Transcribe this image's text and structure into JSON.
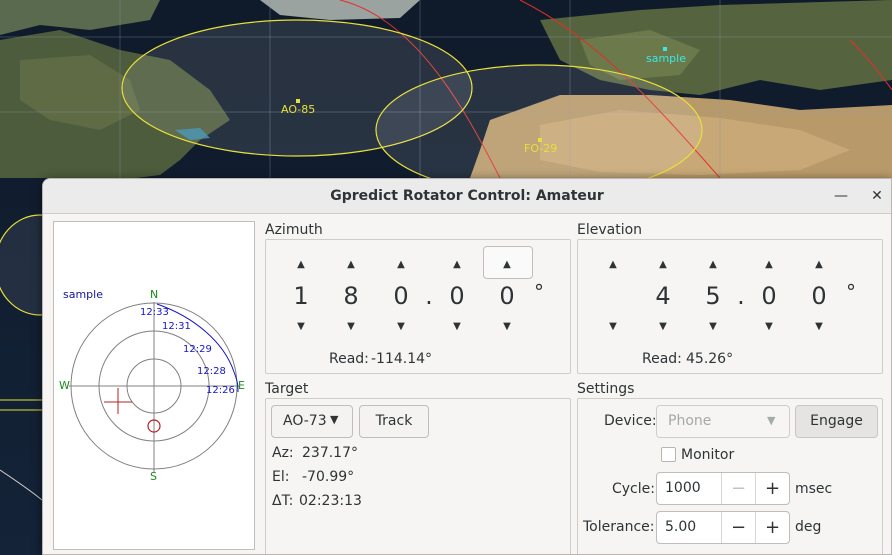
{
  "window": {
    "title": "Gpredict Rotator Control: Amateur",
    "minimize_icon": "minimize-icon",
    "close_icon": "close-icon"
  },
  "map": {
    "satellites": [
      {
        "name": "AO-85",
        "color": "#e8e03a"
      },
      {
        "name": "FO-29",
        "color": "#e8e03a"
      },
      {
        "name": "sample",
        "color": "#3ae8e8"
      }
    ]
  },
  "polar": {
    "sat_label": "sample",
    "compass": {
      "n": "N",
      "s": "S",
      "e": "E",
      "w": "W"
    },
    "times": [
      "12:33",
      "12:31",
      "12:29",
      "12:28",
      "12:26"
    ]
  },
  "azimuth": {
    "label": "Azimuth",
    "digits": [
      "1",
      "8",
      "0",
      ".",
      "0",
      "0",
      "°"
    ],
    "read_label": "Read:",
    "read_value": "-114.14°"
  },
  "elevation": {
    "label": "Elevation",
    "digits": [
      "4",
      "5",
      ".",
      "0",
      "0",
      "°"
    ],
    "read_label": "Read:",
    "read_value": "45.26°"
  },
  "target": {
    "label": "Target",
    "satellite": "AO-73",
    "track_button": "Track",
    "az_label": "Az:",
    "az_value": "237.17°",
    "el_label": "El:",
    "el_value": "-70.99°",
    "dt_label": "ΔT:",
    "dt_value": "02:23:13"
  },
  "settings": {
    "label": "Settings",
    "device_label": "Device:",
    "device_value": "Phone",
    "engage_button": "Engage",
    "monitor_label": "Monitor",
    "monitor_checked": false,
    "cycle_label": "Cycle:",
    "cycle_value": "1000",
    "cycle_unit": "msec",
    "tolerance_label": "Tolerance:",
    "tolerance_value": "5.00",
    "tolerance_unit": "deg",
    "minus": "−",
    "plus": "+"
  }
}
